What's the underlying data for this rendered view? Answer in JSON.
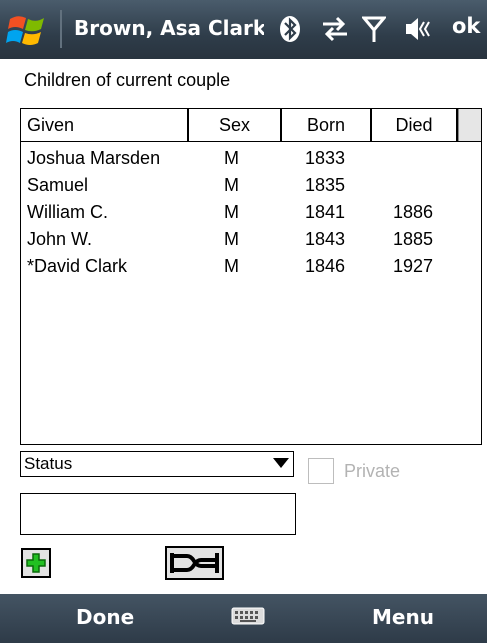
{
  "titlebar": {
    "title": "Brown, Asa Clark &",
    "ok_label": "ok",
    "icons": [
      "windows-start-icon",
      "bluetooth-icon",
      "sync-icon",
      "signal-icon",
      "volume-icon"
    ]
  },
  "section_label": "Children of current couple",
  "table": {
    "columns": [
      "Given",
      "Sex",
      "Born",
      "Died"
    ],
    "rows": [
      {
        "given": "Joshua Marsden",
        "sex": "M",
        "born": "1833",
        "died": ""
      },
      {
        "given": "Samuel",
        "sex": "M",
        "born": "1835",
        "died": ""
      },
      {
        "given": "William C.",
        "sex": "M",
        "born": "1841",
        "died": "1886"
      },
      {
        "given": "John W.",
        "sex": "M",
        "born": "1843",
        "died": "1885"
      },
      {
        "given": "*David Clark",
        "sex": "M",
        "born": "1846",
        "died": "1927"
      }
    ]
  },
  "status": {
    "selected": "Status"
  },
  "private": {
    "label": "Private",
    "checked": false
  },
  "notes_field": {
    "value": ""
  },
  "softkeys": {
    "left": "Done",
    "right": "Menu"
  }
}
